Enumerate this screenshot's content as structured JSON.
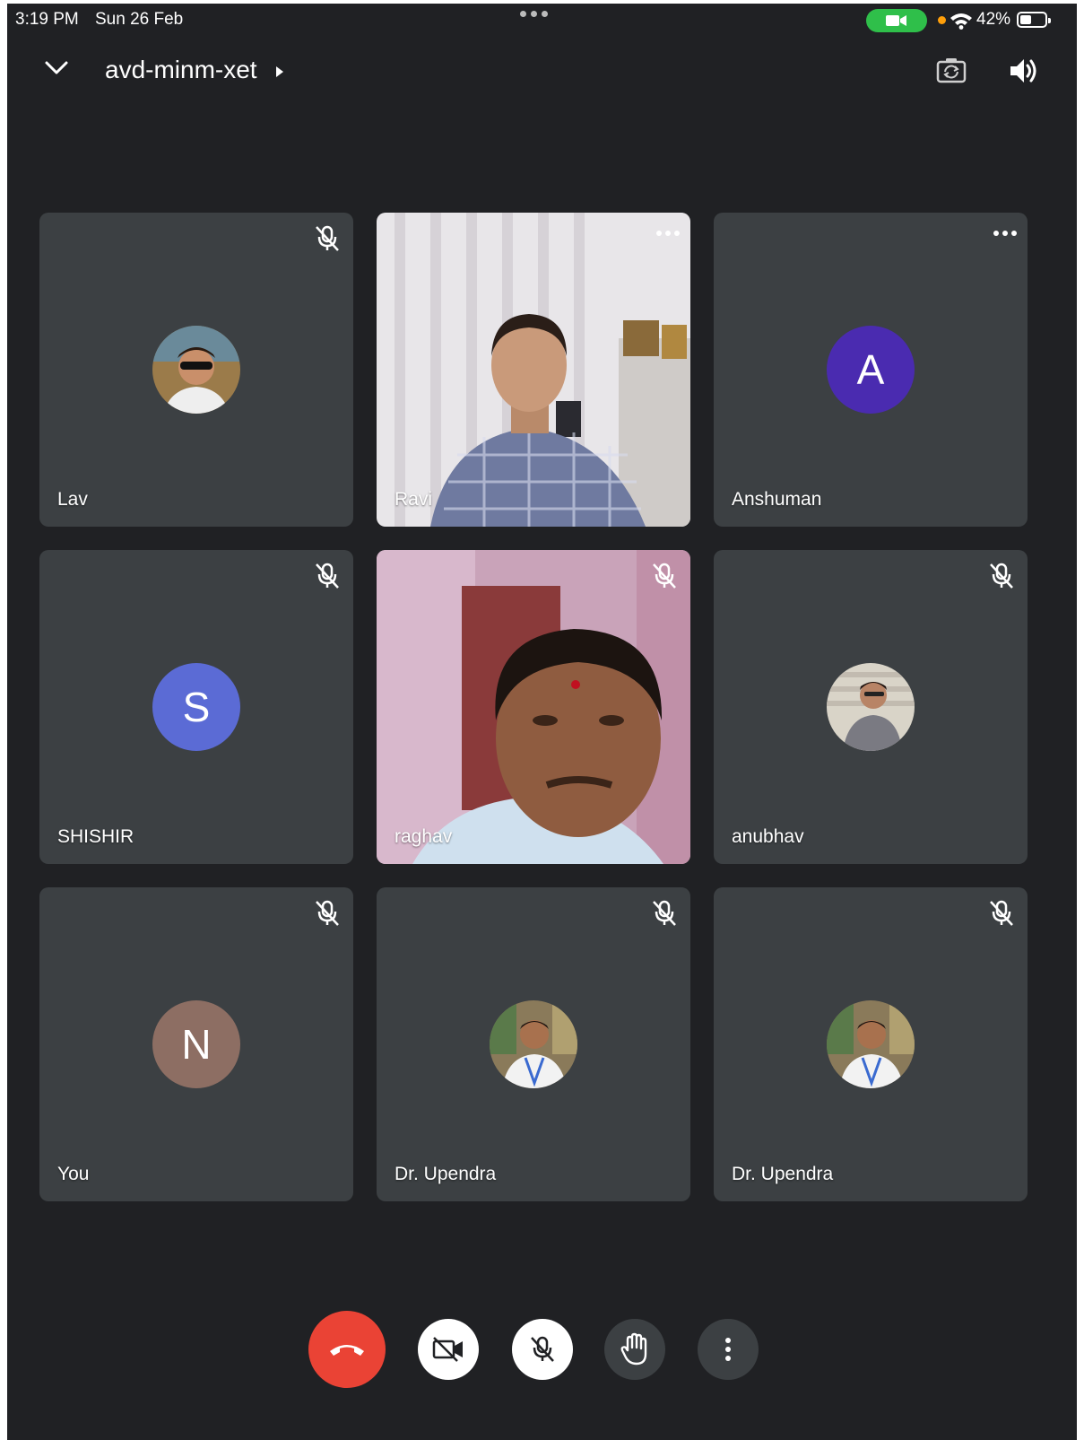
{
  "status_bar": {
    "time": "3:19 PM",
    "date": "Sun 26 Feb",
    "battery": "42%",
    "icons": [
      "camera-active-pill",
      "orange-dot",
      "wifi-icon",
      "battery-icon"
    ]
  },
  "header": {
    "meeting_code": "avd-minm-xet",
    "icons": [
      "chevron-down-icon",
      "caret-right-icon",
      "switch-camera-icon",
      "speaker-icon"
    ]
  },
  "participants": [
    {
      "name": "Lav",
      "type": "photo-avatar",
      "muted": true
    },
    {
      "name": "Ravi",
      "type": "video",
      "muted": false,
      "more_menu": true
    },
    {
      "name": "Anshuman",
      "type": "letter-avatar",
      "letter": "A",
      "color": "#4a2bb0",
      "muted": false,
      "more_menu": true
    },
    {
      "name": "SHISHIR",
      "type": "letter-avatar",
      "letter": "S",
      "color": "#5b6bd5",
      "muted": true
    },
    {
      "name": "raghav",
      "type": "video",
      "muted": true
    },
    {
      "name": "anubhav",
      "type": "photo-avatar",
      "muted": true
    },
    {
      "name": "You",
      "type": "letter-avatar",
      "letter": "N",
      "color": "#8d6e63",
      "muted": true
    },
    {
      "name": "Dr. Upendra",
      "type": "photo-avatar",
      "muted": true
    },
    {
      "name": "Dr. Upendra",
      "type": "photo-avatar",
      "muted": true
    }
  ],
  "controls": {
    "items": [
      "leave-call",
      "camera-off",
      "mic-off",
      "raise-hand",
      "more-options"
    ],
    "leave_color": "#ea4335",
    "active_color": "#ffffff",
    "inactive_color": "#3c4043"
  },
  "colors": {
    "background": "#202124",
    "tile": "#3c4043",
    "accent_green": "#2fbf4a"
  }
}
